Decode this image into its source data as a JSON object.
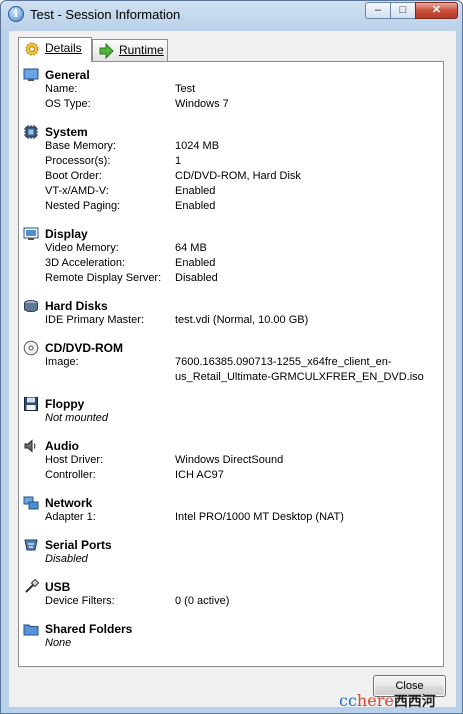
{
  "window": {
    "title": "Test - Session Information"
  },
  "titlebar_buttons": {
    "min": "–",
    "max": "□",
    "close": "✕"
  },
  "tabs": [
    {
      "label": "Details"
    },
    {
      "label": "Runtime"
    }
  ],
  "sections": {
    "general": {
      "title": "General",
      "rows": [
        {
          "key": "Name:",
          "value": "Test"
        },
        {
          "key": "OS Type:",
          "value": "Windows 7"
        }
      ]
    },
    "system": {
      "title": "System",
      "rows": [
        {
          "key": "Base Memory:",
          "value": "1024 MB"
        },
        {
          "key": "Processor(s):",
          "value": "1"
        },
        {
          "key": "Boot Order:",
          "value": "CD/DVD-ROM, Hard Disk"
        },
        {
          "key": "VT-x/AMD-V:",
          "value": "Enabled"
        },
        {
          "key": "Nested Paging:",
          "value": "Enabled"
        }
      ]
    },
    "display": {
      "title": "Display",
      "rows": [
        {
          "key": "Video Memory:",
          "value": "64 MB"
        },
        {
          "key": "3D Acceleration:",
          "value": "Enabled"
        },
        {
          "key": "Remote Display Server:",
          "value": "Disabled"
        }
      ]
    },
    "hard_disks": {
      "title": "Hard Disks",
      "rows": [
        {
          "key": "IDE Primary Master:",
          "value": "test.vdi (Normal, 10.00 GB)"
        }
      ]
    },
    "cd_dvd": {
      "title": "CD/DVD-ROM",
      "rows": [
        {
          "key": "Image:",
          "value_line1": "7600.16385.090713-1255_x64fre_client_en-",
          "value_line2": "us_Retail_Ultimate-GRMCULXFRER_EN_DVD.iso"
        }
      ]
    },
    "floppy": {
      "title": "Floppy",
      "status": "Not mounted"
    },
    "audio": {
      "title": "Audio",
      "rows": [
        {
          "key": "Host Driver:",
          "value": "Windows DirectSound"
        },
        {
          "key": "Controller:",
          "value": "ICH AC97"
        }
      ]
    },
    "network": {
      "title": "Network",
      "rows": [
        {
          "key": "Adapter 1:",
          "value": "Intel PRO/1000 MT Desktop (NAT)"
        }
      ]
    },
    "serial_ports": {
      "title": "Serial Ports",
      "status": "Disabled"
    },
    "usb": {
      "title": "USB",
      "rows": [
        {
          "key": "Device Filters:",
          "value": "0 (0 active)"
        }
      ]
    },
    "shared_folders": {
      "title": "Shared Folders",
      "status": "None"
    }
  },
  "close_button": {
    "label": "Close"
  },
  "watermark": {
    "part1": "cc",
    "part2": "here",
    "part3": "西西河"
  }
}
